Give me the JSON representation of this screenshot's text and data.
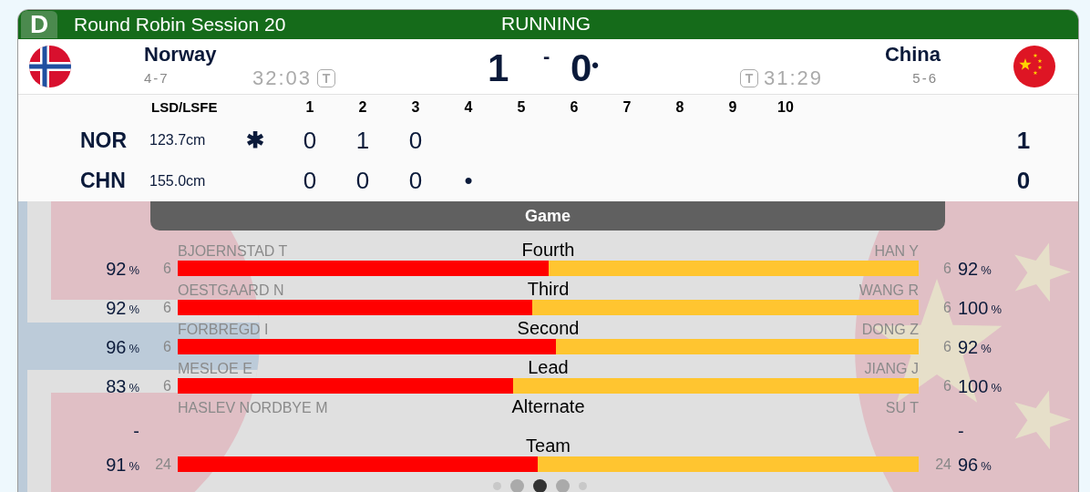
{
  "header": {
    "badge": "D",
    "title": "Round Robin Session 20",
    "status": "RUNNING"
  },
  "teams": [
    {
      "name": "Norway",
      "record": "4-7",
      "time": "32:03",
      "timeout_label": "T",
      "score": "1",
      "kind": "norway"
    },
    {
      "name": "China",
      "record": "5-6",
      "time": "31:29",
      "timeout_label": "T",
      "score": "0",
      "score_mark": "•",
      "kind": "china"
    }
  ],
  "score_separator": "-",
  "linescore": {
    "lsd_heading": "LSD/LSFE",
    "ends": [
      "1",
      "2",
      "3",
      "4",
      "5",
      "6",
      "7",
      "8",
      "9",
      "10"
    ],
    "rows": [
      {
        "code": "NOR",
        "lsd": "123.7cm",
        "marker": "✱",
        "ends": [
          "0",
          "1",
          "0"
        ],
        "total": "1"
      },
      {
        "code": "CHN",
        "lsd": "155.0cm",
        "ends": [
          "0",
          "0",
          "0",
          "•"
        ],
        "total": "0"
      }
    ]
  },
  "tab": "Game",
  "positions": [
    {
      "role": "Fourth",
      "left": {
        "name": "BJOERNSTAD T",
        "count": "6",
        "pct": "92",
        "unit": "%"
      },
      "right": {
        "name": "HAN Y",
        "count": "6",
        "pct": "92",
        "unit": "%"
      },
      "level": 0.5
    },
    {
      "role": "Third",
      "left": {
        "name": "OESTGAARD N",
        "count": "6",
        "pct": "92",
        "unit": "%"
      },
      "right": {
        "name": "WANG R",
        "count": "6",
        "pct": "100",
        "unit": "%"
      },
      "level": 0.478
    },
    {
      "role": "Second",
      "left": {
        "name": "FORBREGD I",
        "count": "6",
        "pct": "96",
        "unit": "%"
      },
      "right": {
        "name": "DONG Z",
        "count": "6",
        "pct": "92",
        "unit": "%"
      },
      "level": 0.51
    },
    {
      "role": "Lead",
      "left": {
        "name": "MESLOE E",
        "count": "6",
        "pct": "83",
        "unit": "%"
      },
      "right": {
        "name": "JIANG J",
        "count": "6",
        "pct": "100",
        "unit": "%"
      },
      "level": 0.453
    },
    {
      "role": "Alternate",
      "left": {
        "name": "HASLEV NORDBYE M",
        "pct": "-"
      },
      "right": {
        "name": "SU T",
        "pct": "-"
      }
    },
    {
      "role": "Team",
      "left": {
        "count": "24",
        "pct": "91",
        "unit": "%"
      },
      "right": {
        "count": "24",
        "pct": "96",
        "unit": "%"
      },
      "level": 0.486
    }
  ],
  "pagination": [
    {
      "selected": false
    },
    {
      "selected": false
    },
    {
      "selected": true
    },
    {
      "selected": false
    },
    {
      "selected": false
    }
  ]
}
